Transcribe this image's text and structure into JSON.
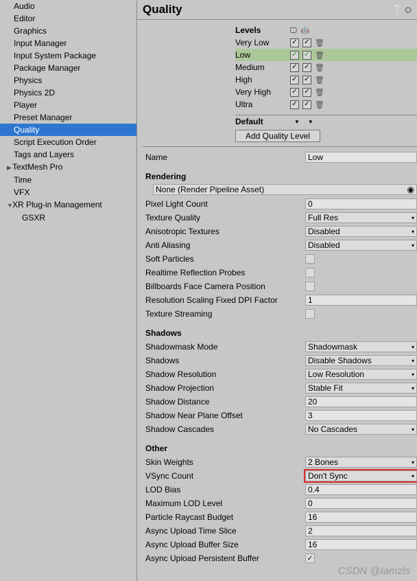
{
  "header": {
    "title": "Quality"
  },
  "sidebar": {
    "items": [
      {
        "label": "Audio"
      },
      {
        "label": "Editor"
      },
      {
        "label": "Graphics"
      },
      {
        "label": "Input Manager"
      },
      {
        "label": "Input System Package"
      },
      {
        "label": "Package Manager"
      },
      {
        "label": "Physics"
      },
      {
        "label": "Physics 2D"
      },
      {
        "label": "Player"
      },
      {
        "label": "Preset Manager"
      },
      {
        "label": "Quality"
      },
      {
        "label": "Script Execution Order"
      },
      {
        "label": "Tags and Layers"
      },
      {
        "label": "TextMesh Pro"
      },
      {
        "label": "Time"
      },
      {
        "label": "VFX"
      },
      {
        "label": "XR Plug-in Management"
      },
      {
        "label": "GSXR"
      }
    ]
  },
  "levels": {
    "header": "Levels",
    "rows": [
      {
        "label": "Very Low"
      },
      {
        "label": "Low"
      },
      {
        "label": "Medium"
      },
      {
        "label": "High"
      },
      {
        "label": "Very High"
      },
      {
        "label": "Ultra"
      }
    ],
    "default_label": "Default",
    "add_button": "Add Quality Level"
  },
  "name": {
    "label": "Name",
    "value": "Low"
  },
  "rendering": {
    "header": "Rendering",
    "rpa": "None (Render Pipeline Asset)",
    "pixel_light": {
      "label": "Pixel Light Count",
      "value": "0"
    },
    "texture_quality": {
      "label": "Texture Quality",
      "value": "Full Res"
    },
    "anisotropic": {
      "label": "Anisotropic Textures",
      "value": "Disabled"
    },
    "aa": {
      "label": "Anti Aliasing",
      "value": "Disabled"
    },
    "soft_particles": {
      "label": "Soft Particles"
    },
    "reflection_probes": {
      "label": "Realtime Reflection Probes"
    },
    "billboards": {
      "label": "Billboards Face Camera Position"
    },
    "res_scaling": {
      "label": "Resolution Scaling Fixed DPI Factor",
      "value": "1"
    },
    "tex_streaming": {
      "label": "Texture Streaming"
    }
  },
  "shadows": {
    "header": "Shadows",
    "mask_mode": {
      "label": "Shadowmask Mode",
      "value": "Shadowmask"
    },
    "shadows": {
      "label": "Shadows",
      "value": "Disable Shadows"
    },
    "resolution": {
      "label": "Shadow Resolution",
      "value": "Low Resolution"
    },
    "projection": {
      "label": "Shadow Projection",
      "value": "Stable Fit"
    },
    "distance": {
      "label": "Shadow Distance",
      "value": "20"
    },
    "near_plane": {
      "label": "Shadow Near Plane Offset",
      "value": "3"
    },
    "cascades": {
      "label": "Shadow Cascades",
      "value": "No Cascades"
    }
  },
  "other": {
    "header": "Other",
    "skin_weights": {
      "label": "Skin Weights",
      "value": "2 Bones"
    },
    "vsync": {
      "label": "VSync Count",
      "value": "Don't Sync"
    },
    "lod_bias": {
      "label": "LOD Bias",
      "value": "0.4"
    },
    "max_lod": {
      "label": "Maximum LOD Level",
      "value": "0"
    },
    "raycast_budget": {
      "label": "Particle Raycast Budget",
      "value": "16"
    },
    "upload_time": {
      "label": "Async Upload Time Slice",
      "value": "2"
    },
    "upload_buffer": {
      "label": "Async Upload Buffer Size",
      "value": "16"
    },
    "upload_persistent": {
      "label": "Async Upload Persistent Buffer"
    }
  },
  "watermark": "CSDN @Iamzls"
}
